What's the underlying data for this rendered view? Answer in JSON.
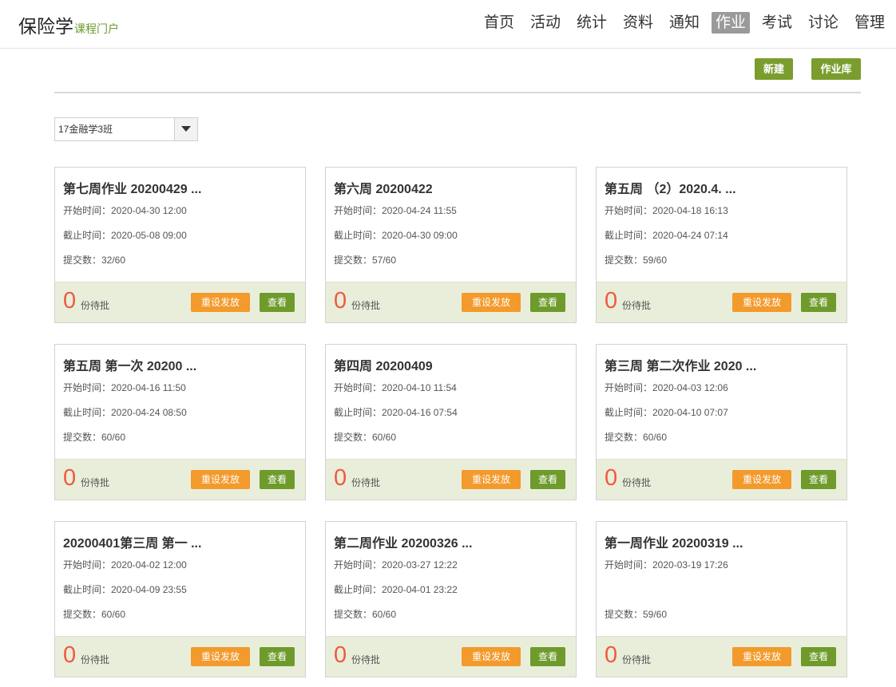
{
  "header": {
    "title": "保险学",
    "subtitle": "课程门户",
    "nav": [
      {
        "label": "首页",
        "active": false
      },
      {
        "label": "活动",
        "active": false
      },
      {
        "label": "统计",
        "active": false
      },
      {
        "label": "资料",
        "active": false
      },
      {
        "label": "通知",
        "active": false
      },
      {
        "label": "作业",
        "active": true
      },
      {
        "label": "考试",
        "active": false
      },
      {
        "label": "讨论",
        "active": false
      },
      {
        "label": "管理",
        "active": false
      }
    ]
  },
  "toolbar": {
    "new_label": "新建",
    "library_label": "作业库"
  },
  "class_select": {
    "value": "17金融学3班"
  },
  "labels": {
    "pending_suffix": "份待批",
    "reset_button": "重设发放",
    "view_button": "查看"
  },
  "colors": {
    "accent_green": "#7a9d2e",
    "reset_orange": "#f39a2c",
    "pending_red": "#f05a3c",
    "active_nav": "#9a9a9a",
    "card_footer": "#e9eedb"
  },
  "assignments": [
    {
      "title": "第七周作业 20200429 ...",
      "start": "开始时间：2020-04-30 12:00",
      "end": "截止时间：2020-05-08 09:00",
      "submitted": "提交数：32/60",
      "pending": "0"
    },
    {
      "title": "第六周 20200422",
      "start": "开始时间：2020-04-24 11:55",
      "end": "截止时间：2020-04-30 09:00",
      "submitted": "提交数：57/60",
      "pending": "0"
    },
    {
      "title": "第五周 （2）2020.4. ...",
      "start": "开始时间：2020-04-18 16:13",
      "end": "截止时间：2020-04-24 07:14",
      "submitted": "提交数：59/60",
      "pending": "0"
    },
    {
      "title": "第五周 第一次 20200 ...",
      "start": "开始时间：2020-04-16 11:50",
      "end": "截止时间：2020-04-24 08:50",
      "submitted": "提交数：60/60",
      "pending": "0"
    },
    {
      "title": "第四周 20200409",
      "start": "开始时间：2020-04-10 11:54",
      "end": "截止时间：2020-04-16 07:54",
      "submitted": "提交数：60/60",
      "pending": "0"
    },
    {
      "title": "第三周 第二次作业 2020 ...",
      "start": "开始时间：2020-04-03 12:06",
      "end": "截止时间：2020-04-10 07:07",
      "submitted": "提交数：60/60",
      "pending": "0"
    },
    {
      "title": "20200401第三周 第一 ...",
      "start": "开始时间：2020-04-02 12:00",
      "end": "截止时间：2020-04-09 23:55",
      "submitted": "提交数：60/60",
      "pending": "0"
    },
    {
      "title": "第二周作业 20200326 ...",
      "start": "开始时间：2020-03-27 12:22",
      "end": "截止时间：2020-04-01 23:22",
      "submitted": "提交数：60/60",
      "pending": "0"
    },
    {
      "title": "第一周作业 20200319 ...",
      "start": "开始时间：2020-03-19 17:26",
      "end": "",
      "submitted": "提交数：59/60",
      "pending": "0"
    }
  ]
}
